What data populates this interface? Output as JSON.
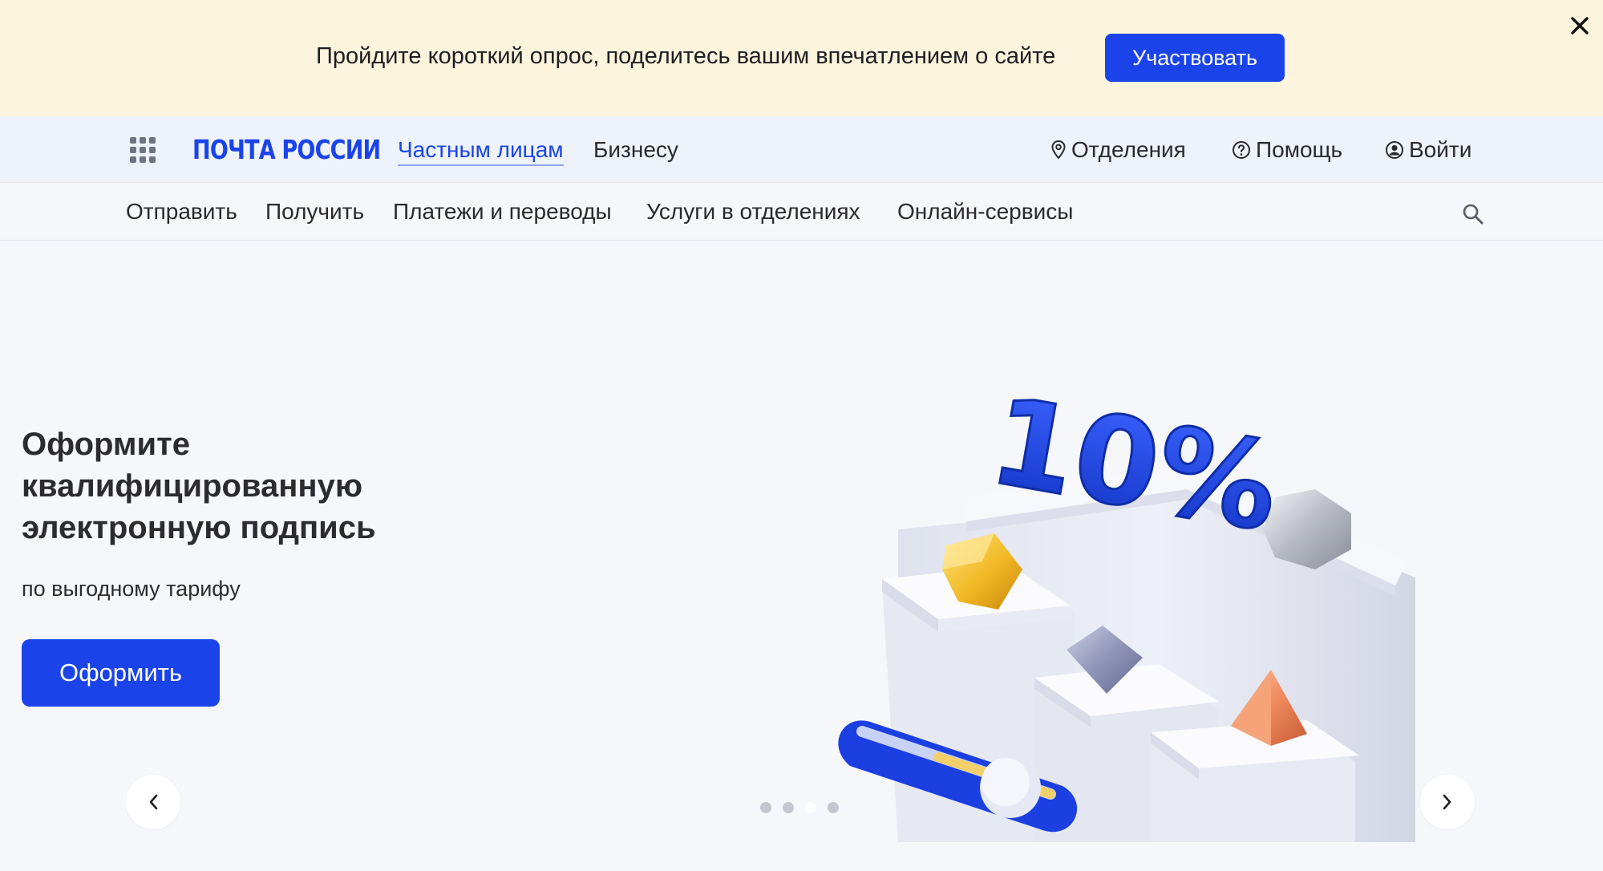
{
  "survey": {
    "text": "Пройдите короткий опрос, поделитесь вашим впечатлением о сайте",
    "button_label": "Участвовать",
    "close_icon": "close-icon"
  },
  "header": {
    "logo": "ПОЧТА РОССИИ",
    "apps_icon": "apps-grid-icon",
    "nav": [
      {
        "label": "Частным лицам",
        "active": true
      },
      {
        "label": "Бизнесу",
        "active": false
      }
    ],
    "offices": {
      "label": "Отделения",
      "icon": "location-pin-icon"
    },
    "help": {
      "label": "Помощь",
      "icon": "help-circle-icon"
    },
    "login": {
      "label": "Войти",
      "icon": "user-circle-icon"
    }
  },
  "subnav": {
    "items": [
      "Отправить",
      "Получить",
      "Платежи и переводы",
      "Услуги в отделениях",
      "Онлайн-сервисы"
    ],
    "search_icon": "search-icon"
  },
  "hero": {
    "title": "Оформите квалифицированную электронную подпись",
    "subtitle": "по выгодному тарифу",
    "button_label": "Оформить",
    "illustration_text": "10%",
    "prev_icon": "chevron-left-icon",
    "next_icon": "chevron-right-icon",
    "slides_total": 4,
    "active_slide": 3
  },
  "colors": {
    "brand_blue": "#1a44ea",
    "survey_bg": "#fdf4dd",
    "header_bg": "#eef2fb",
    "page_bg": "#f6f7fb"
  }
}
